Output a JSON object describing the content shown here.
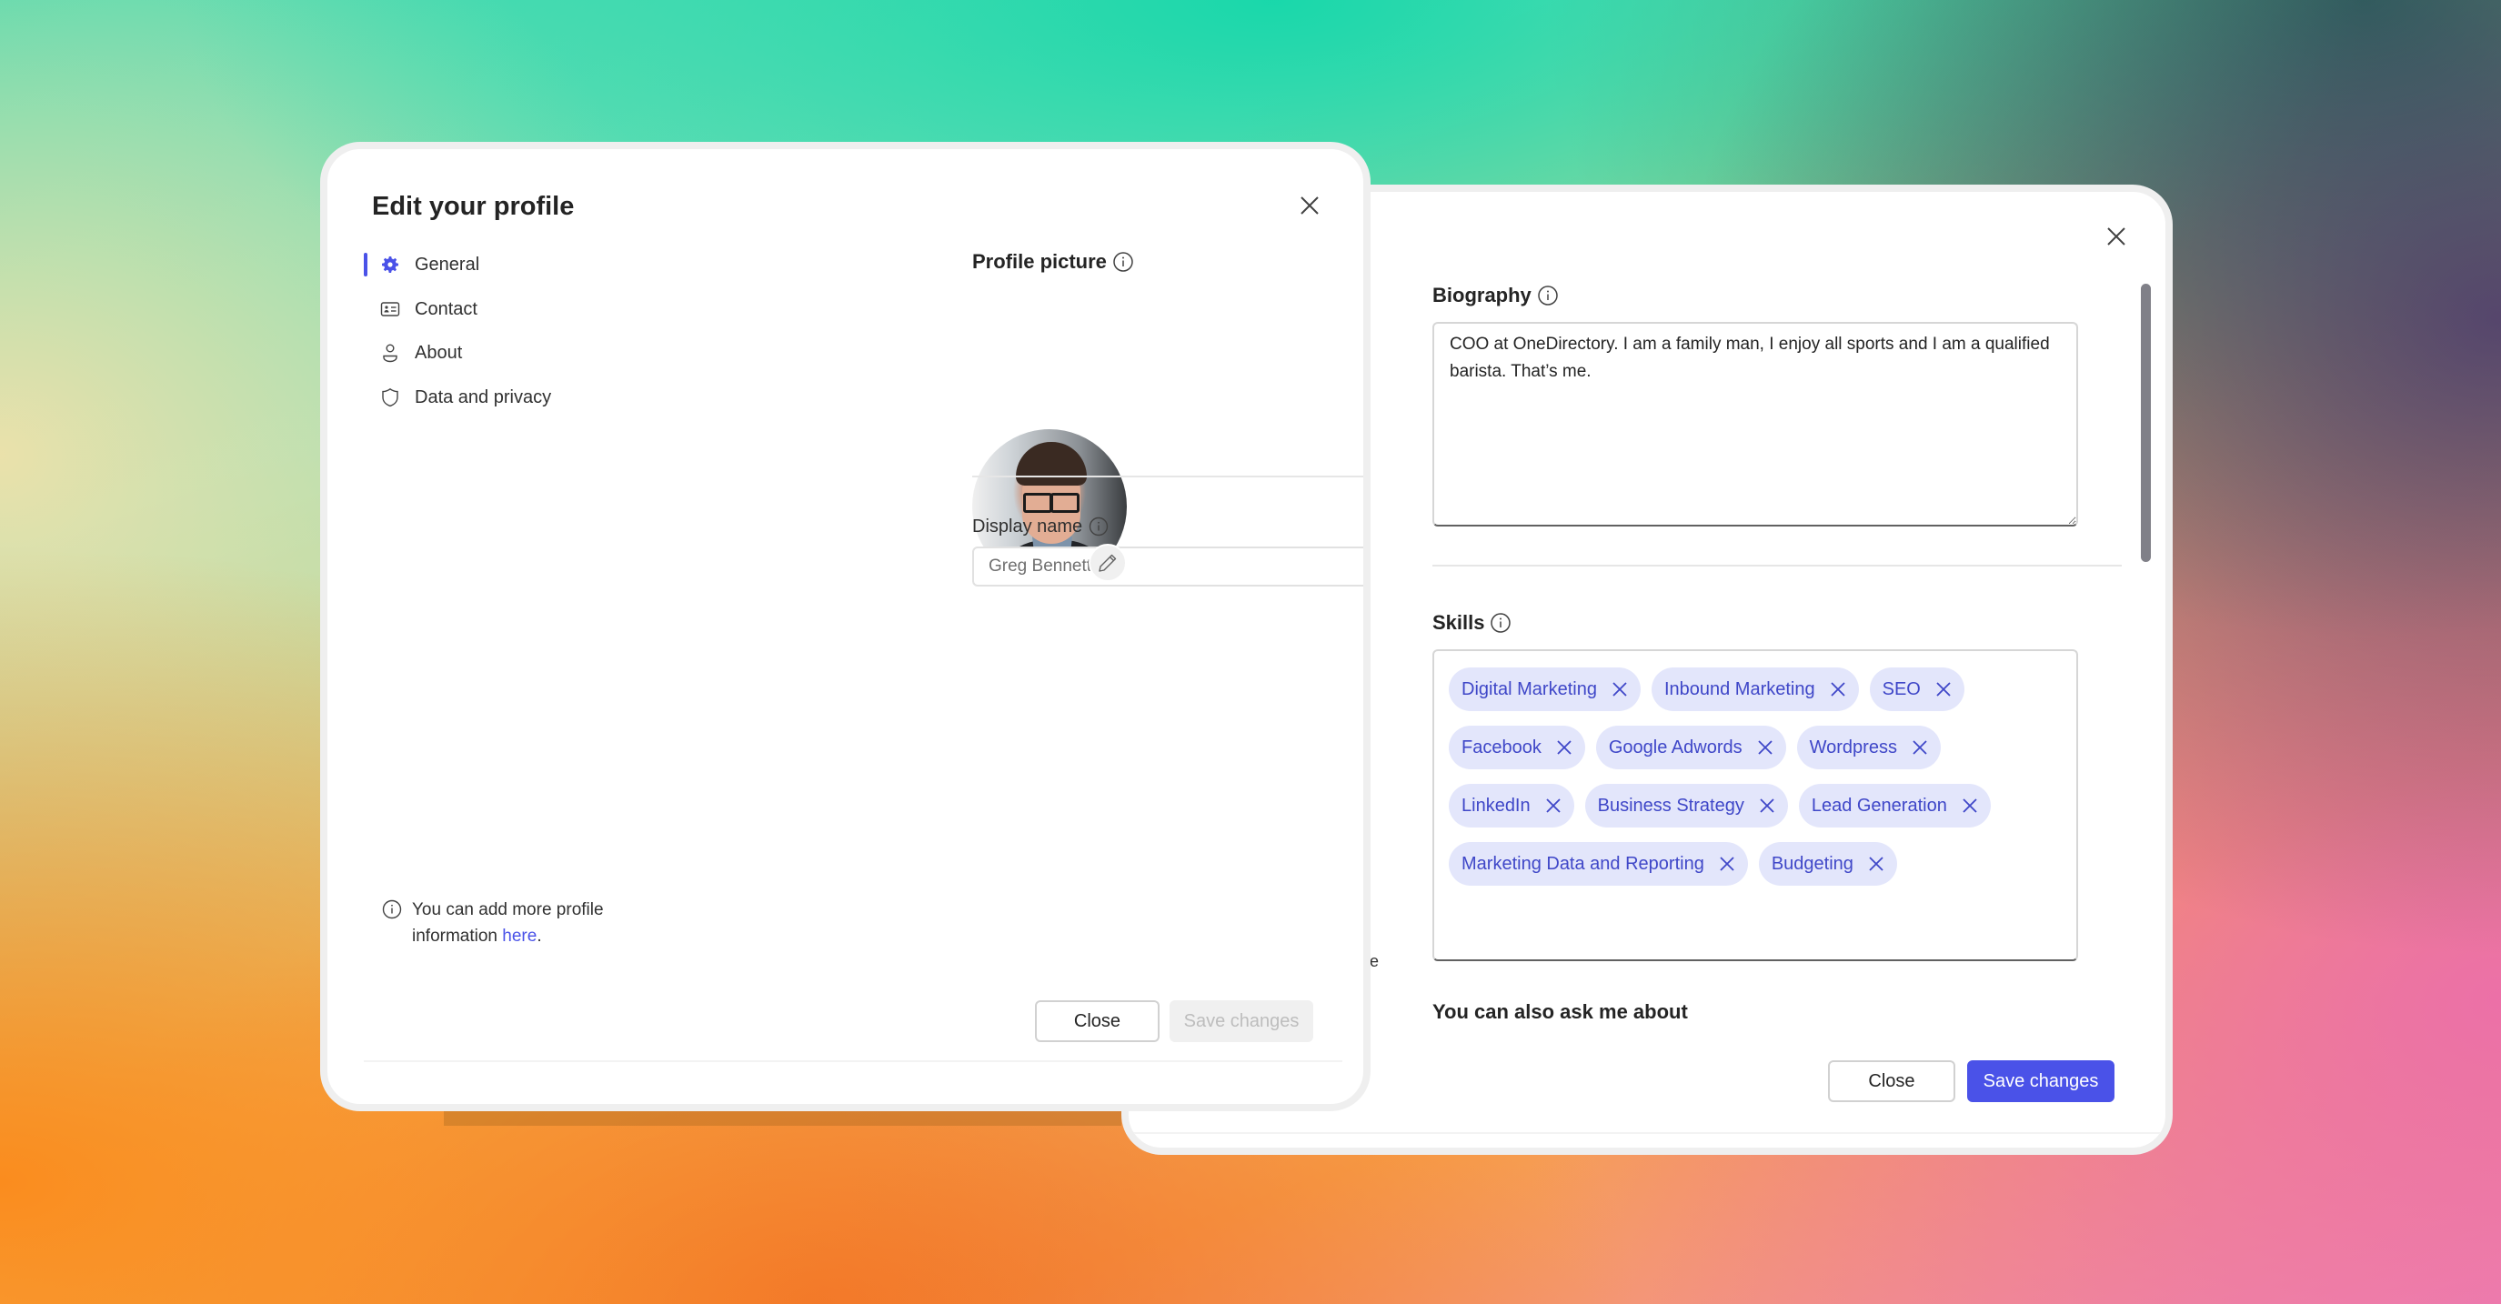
{
  "left_dialog": {
    "title": "Edit your profile",
    "close_icon": "close-icon",
    "nav": {
      "items": [
        {
          "label": "General",
          "icon": "gear-icon",
          "active": true
        },
        {
          "label": "Contact",
          "icon": "contact-card-icon",
          "active": false
        },
        {
          "label": "About",
          "icon": "person-icon",
          "active": false
        },
        {
          "label": "Data and privacy",
          "icon": "shield-icon",
          "active": false
        }
      ]
    },
    "profile_picture": {
      "label": "Profile picture",
      "info_icon": "info-icon",
      "edit_icon": "pencil-icon"
    },
    "display_name": {
      "label": "Display name",
      "value": "Greg Bennett"
    },
    "note": {
      "text": "You can add more profile information ",
      "link_text": "here",
      "suffix": "."
    },
    "buttons": {
      "close": "Close",
      "save": "Save changes",
      "save_enabled": false
    }
  },
  "right_dialog": {
    "close_icon": "close-icon",
    "biography": {
      "label": "Biography",
      "value": "COO at OneDirectory. I am a family man, I enjoy all sports and I am a qualified barista. That’s me."
    },
    "skills": {
      "label": "Skills",
      "items": [
        "Digital Marketing",
        "Inbound Marketing",
        "SEO",
        "Facebook",
        "Google Adwords",
        "Wordpress",
        "LinkedIn",
        "Business Strategy",
        "Lead Generation",
        "Marketing Data and Reporting",
        "Budgeting"
      ]
    },
    "ask_me_about": {
      "label": "You can also ask me about"
    },
    "peek_text": "e",
    "buttons": {
      "close": "Close",
      "save": "Save changes",
      "save_enabled": true
    }
  },
  "colors": {
    "accent": "#4a52e8",
    "chip_background": "#e3e6fb",
    "chip_text": "#3f47c8",
    "dialog_border": "#efefef",
    "disabled_button": "#f0f0f0"
  }
}
